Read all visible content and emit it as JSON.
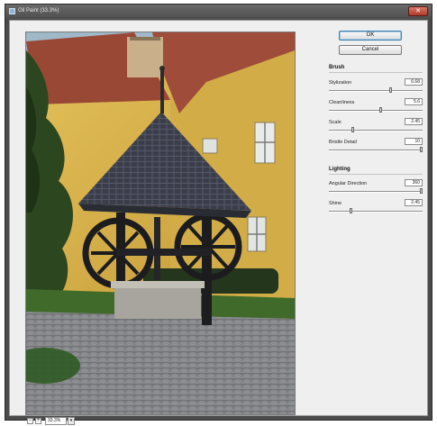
{
  "window": {
    "title": "Oil Paint (33.3%)",
    "close_glyph": "✕"
  },
  "buttons": {
    "ok_label": "OK",
    "cancel_label": "Cancel"
  },
  "brush": {
    "title": "Brush",
    "params": [
      {
        "label": "Stylization",
        "value": "6.68",
        "fraction": 0.67
      },
      {
        "label": "Cleanliness",
        "value": "5.6",
        "fraction": 0.56
      },
      {
        "label": "Scale",
        "value": "2.45",
        "fraction": 0.25
      },
      {
        "label": "Bristle Detail",
        "value": "10",
        "fraction": 1.0
      }
    ]
  },
  "lighting": {
    "title": "Lighting",
    "params": [
      {
        "label": "Angular Direction",
        "value": "360",
        "fraction": 1.0
      },
      {
        "label": "Shine",
        "value": "2.45",
        "fraction": 0.24
      }
    ]
  },
  "status": {
    "zoom_out_glyph": "−",
    "zoom_in_glyph": "+",
    "zoom_value": "33.3%",
    "dropdown_glyph": "▾"
  },
  "icons": {
    "app": "oil-paint-app-icon",
    "close": "close-icon",
    "zoom_out": "zoom-out-icon",
    "zoom_in": "zoom-in-icon",
    "dropdown": "chevron-down-icon"
  },
  "colors": {
    "wall": "#d6b04a",
    "roof": "#9c4a38",
    "gazebo_roof": "#3a3d48",
    "tree": "#2e4a22",
    "cobble": "#7d7d80",
    "grass": "#3f6a2a"
  }
}
